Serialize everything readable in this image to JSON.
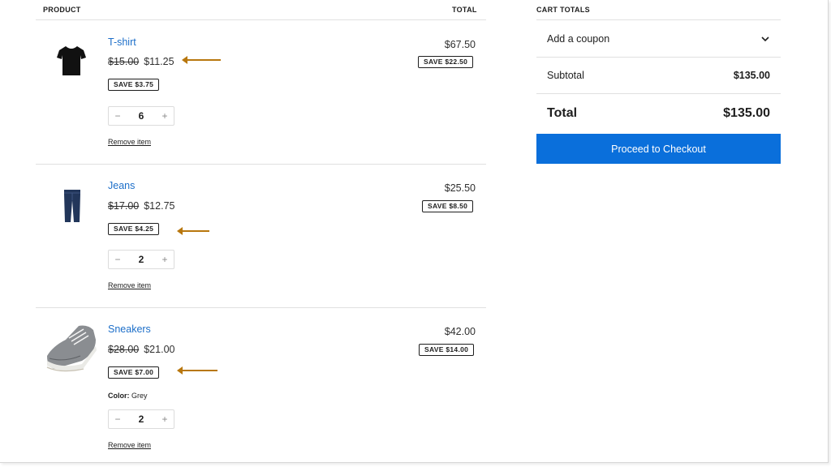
{
  "headers": {
    "product": "PRODUCT",
    "total": "TOTAL",
    "cart_totals": "CART TOTALS"
  },
  "items": [
    {
      "name": "T-shirt",
      "old_price": "$15.00",
      "price": "$11.25",
      "save_badge": "SAVE $3.75",
      "quantity": "6",
      "remove": "Remove item",
      "line_total": "$67.50",
      "line_save": "SAVE $22.50",
      "image_icon": "tshirt-image"
    },
    {
      "name": "Jeans",
      "old_price": "$17.00",
      "price": "$12.75",
      "save_badge": "SAVE $4.25",
      "quantity": "2",
      "remove": "Remove item",
      "line_total": "$25.50",
      "line_save": "SAVE $8.50",
      "image_icon": "jeans-image"
    },
    {
      "name": "Sneakers",
      "old_price": "$28.00",
      "price": "$21.00",
      "save_badge": "SAVE $7.00",
      "attr_label": "Color:",
      "attr_value": "Grey",
      "quantity": "2",
      "remove": "Remove item",
      "line_total": "$42.00",
      "line_save": "SAVE $14.00",
      "image_icon": "sneakers-image"
    }
  ],
  "qty_controls": {
    "minus": "−",
    "plus": "+"
  },
  "totals": {
    "coupon_label": "Add a coupon",
    "subtotal_label": "Subtotal",
    "subtotal_value": "$135.00",
    "total_label": "Total",
    "total_value": "$135.00",
    "checkout_label": "Proceed to Checkout"
  },
  "colors": {
    "accent": "#0a6fdb",
    "link": "#1d6fc9",
    "annotation_arrow": "#b8770e"
  },
  "icons": {
    "coupon_toggle": "chevron-down-icon",
    "annotation": "arrow-left-icon"
  }
}
